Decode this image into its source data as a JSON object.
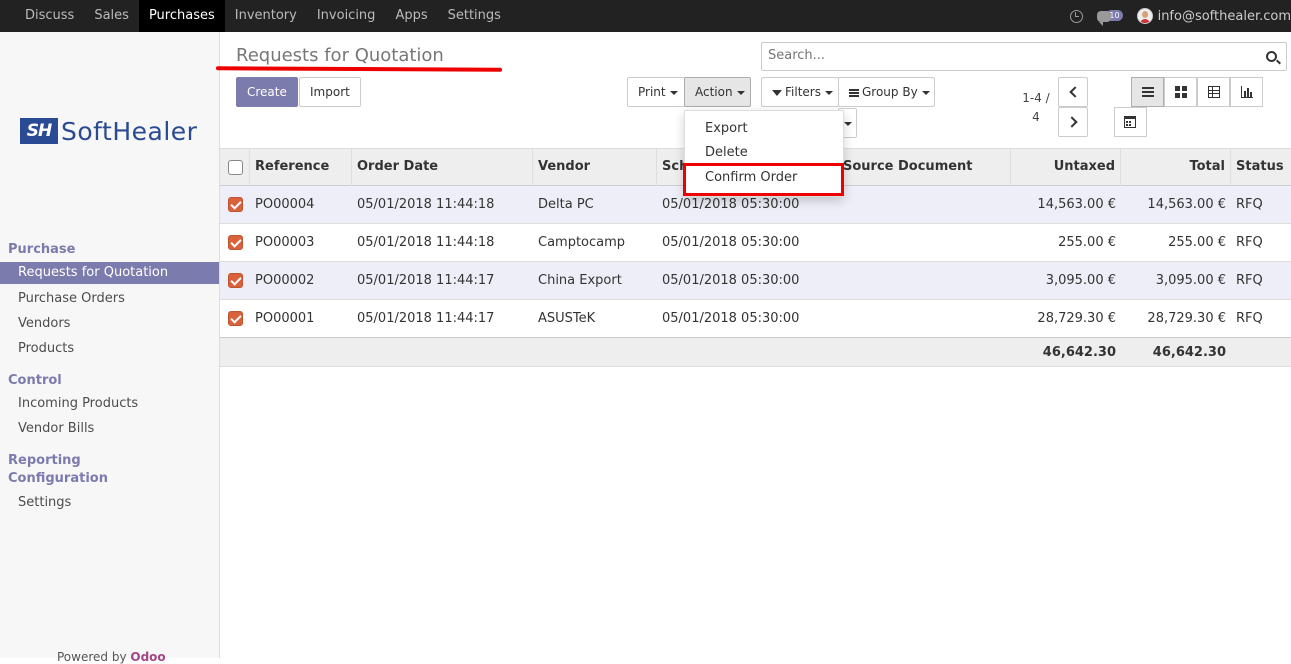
{
  "navbar": {
    "menus": [
      "Discuss",
      "Sales",
      "Purchases",
      "Inventory",
      "Invoicing",
      "Apps",
      "Settings"
    ],
    "active_menu": "Purchases",
    "chat_count": "10",
    "user_email": "info@softhealer.com"
  },
  "sidebar": {
    "logo_mark": "SH",
    "logo_text": "SoftHealer",
    "sections": [
      {
        "title": "Purchase",
        "items": [
          "Requests for Quotation",
          "Purchase Orders",
          "Vendors",
          "Products"
        ]
      },
      {
        "title": "Control",
        "items": [
          "Incoming Products",
          "Vendor Bills"
        ]
      },
      {
        "title": "Reporting",
        "items": []
      },
      {
        "title": "Configuration",
        "items": [
          "Settings"
        ]
      }
    ],
    "active_item": "Requests for Quotation",
    "powered_by": "Powered by",
    "powered_brand": "Odoo"
  },
  "page": {
    "title": "Requests for Quotation"
  },
  "search": {
    "placeholder": "Search..."
  },
  "toolbar": {
    "create_label": "Create",
    "import_label": "Import",
    "print_label": "Print",
    "action_label": "Action",
    "filters_label": "Filters",
    "groupby_label": "Group By"
  },
  "pager": {
    "value": "1-4 / 4"
  },
  "action_menu": {
    "items": [
      "Export",
      "Delete",
      "Confirm Order"
    ],
    "highlighted": "Confirm Order"
  },
  "table": {
    "columns": [
      "Reference",
      "Order Date",
      "Vendor",
      "Sch",
      "Source Document",
      "Untaxed",
      "Total",
      "Status"
    ],
    "rows": [
      {
        "checked": true,
        "reference": "PO00004",
        "order_date": "05/01/2018 11:44:18",
        "vendor": "Delta PC",
        "scheduled": "05/01/2018 05:30:00",
        "source": "",
        "untaxed": "14,563.00 €",
        "total": "14,563.00 €",
        "status": "RFQ"
      },
      {
        "checked": true,
        "reference": "PO00003",
        "order_date": "05/01/2018 11:44:18",
        "vendor": "Camptocamp",
        "scheduled": "05/01/2018 05:30:00",
        "source": "",
        "untaxed": "255.00 €",
        "total": "255.00 €",
        "status": "RFQ"
      },
      {
        "checked": true,
        "reference": "PO00002",
        "order_date": "05/01/2018 11:44:17",
        "vendor": "China Export",
        "scheduled": "05/01/2018 05:30:00",
        "source": "",
        "untaxed": "3,095.00 €",
        "total": "3,095.00 €",
        "status": "RFQ"
      },
      {
        "checked": true,
        "reference": "PO00001",
        "order_date": "05/01/2018 11:44:17",
        "vendor": "ASUSTeK",
        "scheduled": "05/01/2018 05:30:00",
        "source": "",
        "untaxed": "28,729.30 €",
        "total": "28,729.30 €",
        "status": "RFQ"
      }
    ],
    "totals": {
      "untaxed": "46,642.30",
      "total": "46,642.30"
    }
  },
  "colors": {
    "primary": "#7c7bad",
    "checkbox": "#d9613b",
    "highlight": "#e00000",
    "navbar": "#222222",
    "logo": "#2a4a93"
  }
}
